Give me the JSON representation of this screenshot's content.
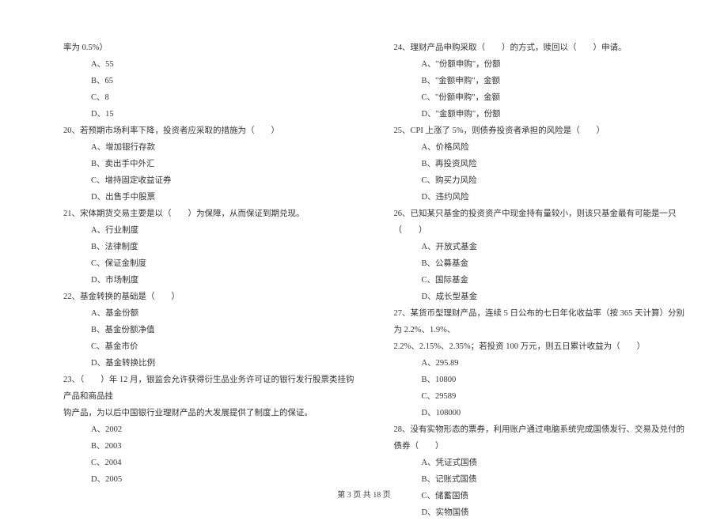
{
  "left_column": {
    "frag1": "率为 0.5%）",
    "opt_a1": "A、55",
    "opt_b1": "B、65",
    "opt_c1": "C、8",
    "opt_d1": "D、15",
    "q20": "20、若预期市场利率下降，投资者应采取的措施为（　　）",
    "opt_a20": "A、增加银行存款",
    "opt_b20": "B、卖出手中外汇",
    "opt_c20": "C、增持固定收益证券",
    "opt_d20": "D、出售手中股票",
    "q21": "21、宋体期货交易主要是以（　　）为保障，从而保证到期兑现。",
    "opt_a21": "A、行业制度",
    "opt_b21": "B、法律制度",
    "opt_c21": "C、保证金制度",
    "opt_d21": "D、市场制度",
    "q22": "22、基金转换的基础是（　　）",
    "opt_a22": "A、基金份额",
    "opt_b22": "B、基金份额净值",
    "opt_c22": "C、基金市价",
    "opt_d22": "D、基金转换比例",
    "q23": "23、（　　）年 12 月，银监会允许获得衍生品业务许可证的银行发行股票类挂钩产品和商品挂",
    "q23b": "钩产品，为以后中国银行业理财产品的大发展提供了制度上的保证。",
    "opt_a23": "A、2002",
    "opt_b23": "B、2003",
    "opt_c23": "C、2004",
    "opt_d23": "D、2005"
  },
  "right_column": {
    "q24": "24、理财产品申购采取（　　）的方式，赎回以（　　）申请。",
    "opt_a24": "A、\"份额申购\"，份额",
    "opt_b24": "B、\"金额申购\"，金额",
    "opt_c24": "C、\"份额申购\"，金额",
    "opt_d24": "D、\"金额申购\"，份额",
    "q25": "25、CPI 上涨了 5%，则债券投资者承担的风险是（　　）",
    "opt_a25": "A、价格风险",
    "opt_b25": "B、再投资风险",
    "opt_c25": "C、购买力风险",
    "opt_d25": "D、违约风险",
    "q26": "26、已知某只基金的投资资产中现金持有量较小，则该只基金最有可能是一只（　　）",
    "opt_a26": "A、开放式基金",
    "opt_b26": "B、公募基金",
    "opt_c26": "C、国际基金",
    "opt_d26": "D、成长型基金",
    "q27": "27、某货币型理财产品，连续 5 日公布的七日年化收益率（按 365 天计算）分别为 2.2%、1.9%、",
    "q27b": "2.2%、2.15%、2.35%；若投资 100 万元，则五日累计收益为（　　）",
    "opt_a27": "A、295.89",
    "opt_b27": "B、10800",
    "opt_c27": "C、29589",
    "opt_d27": "D、108000",
    "q28": "28、没有实物形态的票券，利用账户通过电脑系统完成国债发行、交易及兑付的债券（　　）",
    "opt_a28": "A、凭证式国债",
    "opt_b28": "B、记账式国债",
    "opt_c28": "C、储蓄国债",
    "opt_d28": "D、实物国债"
  },
  "footer": "第 3 页 共 18 页"
}
